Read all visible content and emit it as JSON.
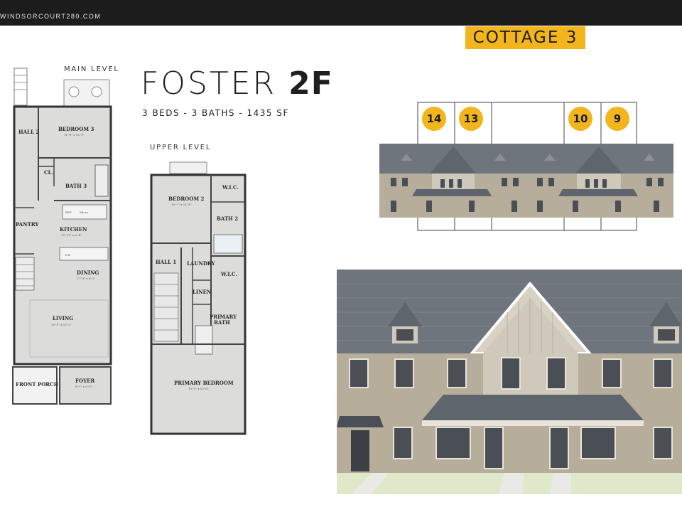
{
  "site_url": "WINDSORCOURT280.COM",
  "badge": "COTTAGE 3",
  "plan": {
    "name_light": "FOSTER",
    "name_bold": "2F",
    "specs": "3 BEDS - 3 BATHS - 1435 SF"
  },
  "levels": {
    "main": "MAIN LEVEL",
    "upper": "UPPER LEVEL"
  },
  "main_rooms": {
    "hall2": "HALL 2",
    "bedroom3": "BEDROOM 3",
    "bedroom3_sub": "11'-8\" x 12'-0\"",
    "closet": "CL.",
    "bath3": "BATH 3",
    "pantry": "PANTRY",
    "ref": "REF",
    "micro": "Micro",
    "kitchen": "KITCHEN",
    "kitchen_sub": "10'-11\" x 9'-4\"",
    "dw": "DW",
    "dining": "DINING",
    "dining_sub": "17'-3\" x 6'-2\"",
    "living": "LIVING",
    "living_sub": "15'-5\" x 15'-2\"",
    "front_porch": "FRONT PORCH",
    "foyer": "FOYER",
    "foyer_sub": "8'-7\" x 5'-5\""
  },
  "upper_rooms": {
    "bedroom2": "BEDROOM 2",
    "bedroom2_sub": "10'-7\" x 11'-8\"",
    "wic1": "W.I.C.",
    "bath2": "BATH 2",
    "hall1": "HALL 1",
    "laundry": "LAUNDRY",
    "wic2": "W.I.C.",
    "linen": "LINEN",
    "primary_bath_1": "PRIMARY",
    "primary_bath_2": "BATH",
    "primary_bedroom": "PRIMARY BEDROOM",
    "primary_bedroom_sub": "15'-5\" x 13'-8\""
  },
  "unit_numbers": [
    "14",
    "13",
    "10",
    "9"
  ],
  "colors": {
    "badge": "#f2b51c",
    "roof": "#6f757c",
    "brick": "#b7ad9b",
    "siding": "#cfc9bb",
    "floor": "#dcdcda",
    "top_bar": "#1c1c1c"
  }
}
